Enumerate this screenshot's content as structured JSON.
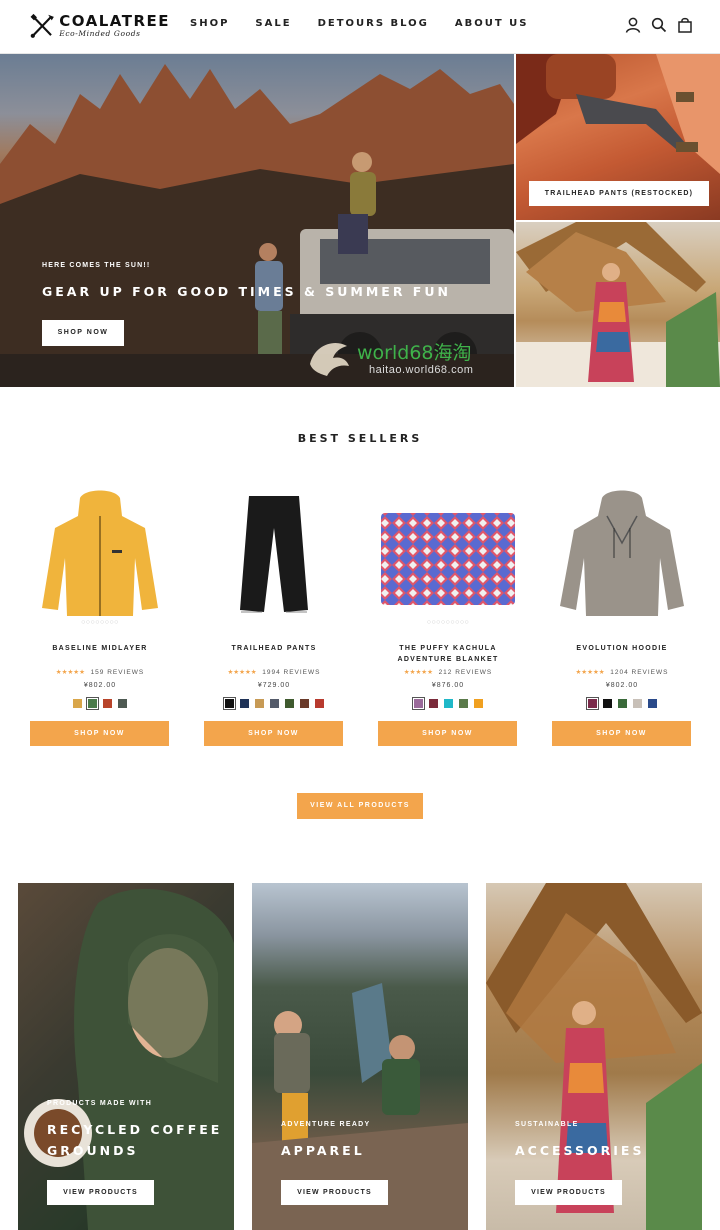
{
  "brand": {
    "name": "COALATREE",
    "tagline": "Eco-Minded Goods"
  },
  "nav": {
    "items": [
      "SHOP",
      "SALE",
      "DETOURS BLOG",
      "ABOUT US"
    ],
    "icons": [
      "account-icon",
      "search-icon",
      "bag-icon"
    ]
  },
  "hero": {
    "eyebrow": "HERE COMES THE SUN!!",
    "title": "GEAR UP FOR GOOD TIMES & SUMMER FUN",
    "button": "SHOP NOW",
    "side_top_button": "TRAILHEAD PANTS (RESTOCKED)"
  },
  "watermark": {
    "text": "world68海淘",
    "sub": "haitao.world68.com"
  },
  "best_sellers": {
    "title": "BEST SELLERS",
    "products": [
      {
        "name": "BASELINE MIDLAYER",
        "stars": "★★★★★",
        "reviews": "159 REVIEWS",
        "price": "¥802.00",
        "swatches": [
          "#d9a64a",
          "#4a7a4a",
          "#b8442a",
          "#4e5a52"
        ],
        "selected": 1,
        "button": "SHOP NOW"
      },
      {
        "name": "TRAILHEAD PANTS",
        "stars": "★★★★★",
        "reviews": "1994 REVIEWS",
        "price": "¥729.00",
        "swatches": [
          "#111111",
          "#1f3358",
          "#c79a55",
          "#545b6a",
          "#3f5a2e",
          "#6a3a2a",
          "#b83a2e"
        ],
        "selected": 0,
        "button": "SHOP NOW"
      },
      {
        "name": "THE PUFFY KACHULA ADVENTURE BLANKET",
        "stars": "★★★★★",
        "reviews": "212 REVIEWS",
        "price": "¥876.00",
        "swatches": [
          "#9a6a9a",
          "#7a2a3a",
          "#1fb8c8",
          "#5a7a4a",
          "#f0a020"
        ],
        "selected": 0,
        "button": "SHOP NOW"
      },
      {
        "name": "EVOLUTION HOODIE",
        "stars": "★★★★★",
        "reviews": "1204 REVIEWS",
        "price": "¥802.00",
        "swatches": [
          "#7a2a4a",
          "#111111",
          "#3a6a3a",
          "#c8c0b8",
          "#2a4a8a"
        ],
        "selected": 0,
        "button": "SHOP NOW"
      }
    ],
    "view_all": "VIEW ALL PRODUCTS"
  },
  "categories": [
    {
      "eyebrow": "PRODUCTS MADE WITH",
      "title": "RECYCLED COFFEE GROUNDS",
      "button": "VIEW PRODUCTS"
    },
    {
      "eyebrow": "ADVENTURE READY",
      "title": "APPAREL",
      "button": "VIEW PRODUCTS"
    },
    {
      "eyebrow": "SUSTAINABLE",
      "title": "ACCESSORIES",
      "button": "VIEW PRODUCTS"
    }
  ],
  "colors": {
    "accent": "#f3a54c",
    "text": "#222222",
    "white": "#ffffff"
  }
}
